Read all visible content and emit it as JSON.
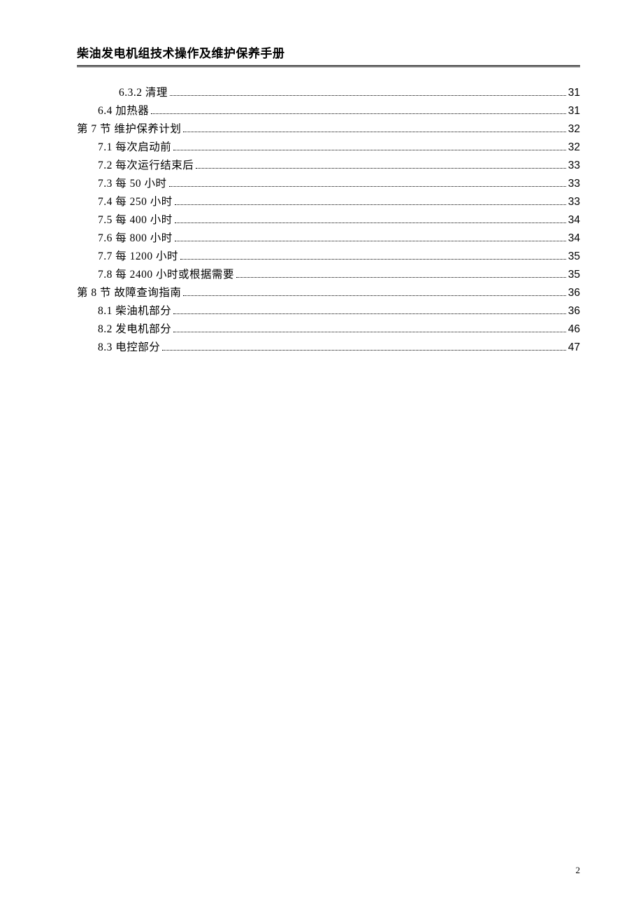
{
  "header": {
    "title": "柴油发电机组技术操作及维护保养手册"
  },
  "toc": {
    "entries": [
      {
        "indent": 2,
        "label": "6.3.2 清理",
        "page": "31"
      },
      {
        "indent": 1,
        "label": "6.4 加热器",
        "page": "31"
      },
      {
        "indent": 0,
        "label": "第 7 节  维护保养计划",
        "page": "32"
      },
      {
        "indent": 1,
        "label": "7.1 每次启动前",
        "page": "32"
      },
      {
        "indent": 1,
        "label": "7.2 每次运行结束后",
        "page": "33"
      },
      {
        "indent": 1,
        "label": "7.3 每 50 小时",
        "page": "33"
      },
      {
        "indent": 1,
        "label": "7.4 每 250 小时",
        "page": "33"
      },
      {
        "indent": 1,
        "label": "7.5 每 400 小时",
        "page": "34"
      },
      {
        "indent": 1,
        "label": "7.6 每 800 小时",
        "page": "34"
      },
      {
        "indent": 1,
        "label": "7.7 每 1200 小时",
        "page": "35"
      },
      {
        "indent": 1,
        "label": "7.8 每 2400 小时或根据需要",
        "page": "35"
      },
      {
        "indent": 0,
        "label": "第 8 节  故障查询指南",
        "page": "36"
      },
      {
        "indent": 1,
        "label": "8.1 柴油机部分",
        "page": "36"
      },
      {
        "indent": 1,
        "label": "8.2 发电机部分",
        "page": "46"
      },
      {
        "indent": 1,
        "label": "8.3 电控部分",
        "page": "47"
      }
    ]
  },
  "footer": {
    "page_number": "2"
  }
}
